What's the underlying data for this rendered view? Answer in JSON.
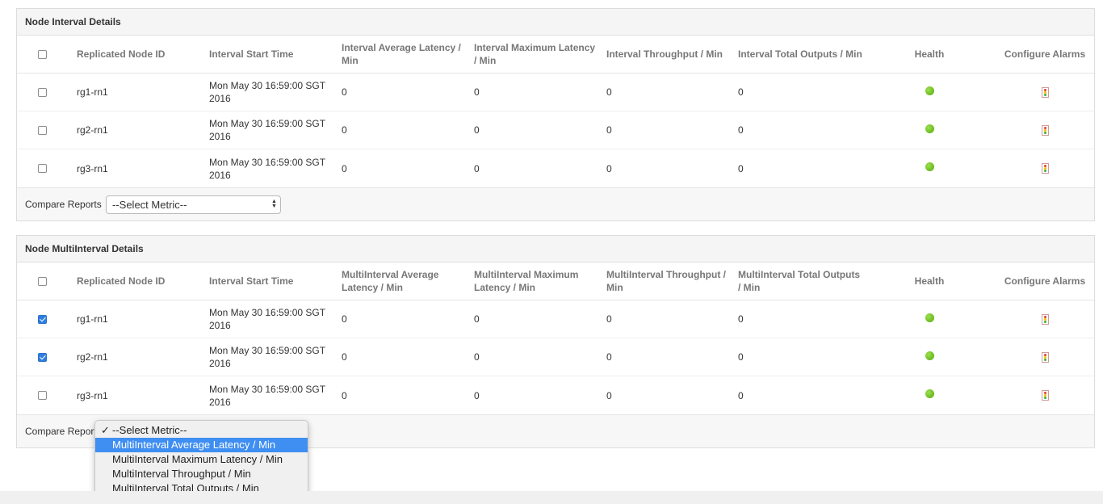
{
  "panels": [
    {
      "title": "Node Interval Details",
      "headers": {
        "node_id": "Replicated Node ID",
        "start_time": "Interval Start Time",
        "avg_latency": "Interval Average Latency / Min",
        "max_latency": "Interval Maximum Latency / Min",
        "throughput": "Interval Throughput / Min",
        "total_outputs": "Interval Total Outputs / Min",
        "health": "Health",
        "alarms": "Configure Alarms"
      },
      "rows": [
        {
          "checked": false,
          "node_id": "rg1-rn1",
          "start_time": "Mon May 30 16:59:00 SGT 2016",
          "avg_latency": "0",
          "max_latency": "0",
          "throughput": "0",
          "total_outputs": "0",
          "health": "green"
        },
        {
          "checked": false,
          "node_id": "rg2-rn1",
          "start_time": "Mon May 30 16:59:00 SGT 2016",
          "avg_latency": "0",
          "max_latency": "0",
          "throughput": "0",
          "total_outputs": "0",
          "health": "green"
        },
        {
          "checked": false,
          "node_id": "rg3-rn1",
          "start_time": "Mon May 30 16:59:00 SGT 2016",
          "avg_latency": "0",
          "max_latency": "0",
          "throughput": "0",
          "total_outputs": "0",
          "health": "green"
        }
      ],
      "compare_label": "Compare Reports",
      "select_value": "--Select Metric--"
    },
    {
      "title": "Node MultiInterval Details",
      "headers": {
        "node_id": "Replicated Node ID",
        "start_time": "Interval Start Time",
        "avg_latency": "MultiInterval Average Latency / Min",
        "max_latency": "MultiInterval Maximum Latency / Min",
        "throughput": "MultiInterval Throughput / Min",
        "total_outputs": "MultiInterval Total Outputs / Min",
        "health": "Health",
        "alarms": "Configure Alarms"
      },
      "rows": [
        {
          "checked": true,
          "node_id": "rg1-rn1",
          "start_time": "Mon May 30 16:59:00 SGT 2016",
          "avg_latency": "0",
          "max_latency": "0",
          "throughput": "0",
          "total_outputs": "0",
          "health": "green"
        },
        {
          "checked": true,
          "node_id": "rg2-rn1",
          "start_time": "Mon May 30 16:59:00 SGT 2016",
          "avg_latency": "0",
          "max_latency": "0",
          "throughput": "0",
          "total_outputs": "0",
          "health": "green"
        },
        {
          "checked": false,
          "node_id": "rg3-rn1",
          "start_time": "Mon May 30 16:59:00 SGT 2016",
          "avg_latency": "0",
          "max_latency": "0",
          "throughput": "0",
          "total_outputs": "0",
          "health": "green"
        }
      ],
      "compare_label": "Compare Reports",
      "select_value": "--Select Metric--"
    }
  ],
  "dropdown": {
    "check_glyph": "✓",
    "options": [
      {
        "label": "--Select Metric--",
        "selected": true,
        "highlighted": false
      },
      {
        "label": "MultiInterval Average Latency / Min",
        "selected": false,
        "highlighted": true
      },
      {
        "label": "MultiInterval Maximum Latency / Min",
        "selected": false,
        "highlighted": false
      },
      {
        "label": "MultiInterval Throughput / Min",
        "selected": false,
        "highlighted": false
      },
      {
        "label": "MultiInterval Total Outputs / Min",
        "selected": false,
        "highlighted": false
      }
    ]
  },
  "colors": {
    "health_ok": "#55a80e",
    "dropdown_highlight": "#3f8ef1",
    "checkbox_checked": "#2f7ee0"
  },
  "icons": {
    "health": "health-status-dot-icon",
    "alarm": "traffic-light-icon"
  }
}
